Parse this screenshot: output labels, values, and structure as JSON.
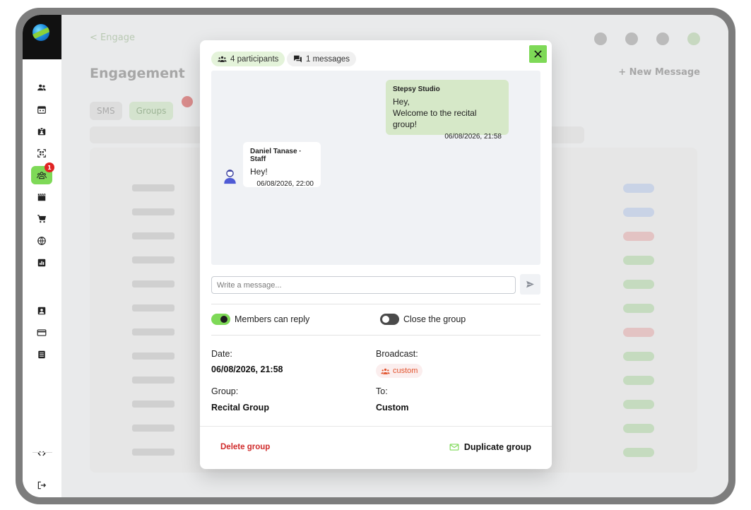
{
  "app": {
    "breadcrumb": "< Engage",
    "page_title": "Engagement",
    "new_button": "+ New Message",
    "tabs": [
      {
        "label": "SMS"
      },
      {
        "label": "Groups"
      }
    ]
  },
  "sidebar": {
    "items": [
      {
        "icon": "people-icon"
      },
      {
        "icon": "calendar-icon"
      },
      {
        "icon": "badge-icon"
      },
      {
        "icon": "qr-scan-icon"
      },
      {
        "icon": "groups-icon",
        "badge": "1",
        "active": true
      },
      {
        "icon": "clapperboard-icon"
      },
      {
        "icon": "cart-icon"
      },
      {
        "icon": "globe-icon"
      },
      {
        "icon": "chart-icon"
      },
      {
        "icon": "contact-card-icon"
      },
      {
        "icon": "credit-card-icon"
      },
      {
        "icon": "list-icon"
      },
      {
        "icon": "code-icon"
      },
      {
        "icon": "logout-icon"
      }
    ]
  },
  "modal": {
    "participants_label": "4 participants",
    "messages_label": "1 messages",
    "chat": {
      "outgoing": {
        "author": "Stepsy Studio",
        "line1": "Hey,",
        "line2": "Welcome to the recital group!",
        "time": "06/08/2026, 21:58"
      },
      "incoming": {
        "author": "Daniel Tanase · Staff",
        "text": "Hey!",
        "time": "06/08/2026, 22:00"
      }
    },
    "input_placeholder": "Write a message...",
    "toggles": {
      "members_reply": {
        "label": "Members can reply",
        "on": true
      },
      "close_group": {
        "label": "Close the group",
        "on": false
      }
    },
    "details": {
      "date_label": "Date:",
      "date_value": "06/08/2026, 21:58",
      "broadcast_label": "Broadcast:",
      "broadcast_value": "custom",
      "group_label": "Group:",
      "group_value": "Recital Group",
      "to_label": "To:",
      "to_value": "Custom"
    },
    "delete_label": "Delete group",
    "duplicate_label": "Duplicate group"
  },
  "colors": {
    "accent": "#7ed957",
    "danger": "#d02b2b",
    "broadcast": "#e2542e",
    "chat_bg": "#f0f2f5",
    "bubble_out": "#d6e8c8"
  }
}
